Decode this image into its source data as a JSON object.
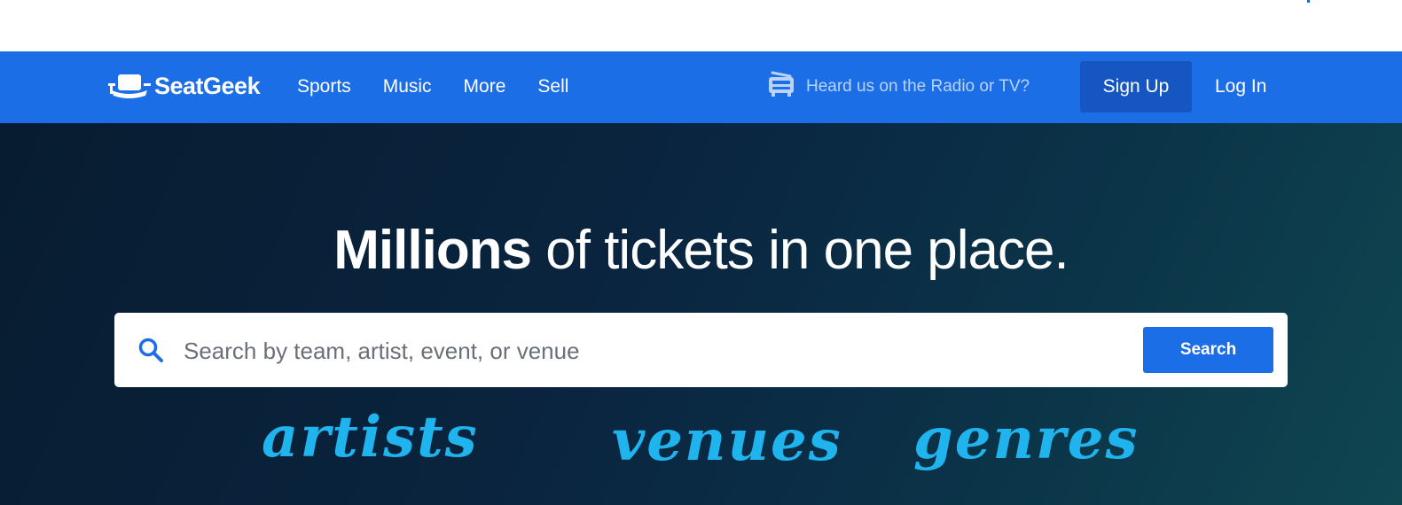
{
  "brand": {
    "name": "SeatGeek",
    "color": "#1c6ee6"
  },
  "nav": {
    "links": [
      "Sports",
      "Music",
      "More",
      "Sell"
    ],
    "promo_icon": "radio-icon",
    "promo_text": "Heard us on the Radio or TV?",
    "signup_label": "Sign Up",
    "login_label": "Log In"
  },
  "hero": {
    "headline_strong": "Millions",
    "headline_rest": " of tickets in one place.",
    "search": {
      "placeholder": "Search by team, artist, event, or venue",
      "value": "",
      "button_label": "Search",
      "icon": "search-icon"
    },
    "scribbles": [
      "artists",
      "venues",
      "genres"
    ],
    "scribble_color": "#1fb4ee"
  }
}
